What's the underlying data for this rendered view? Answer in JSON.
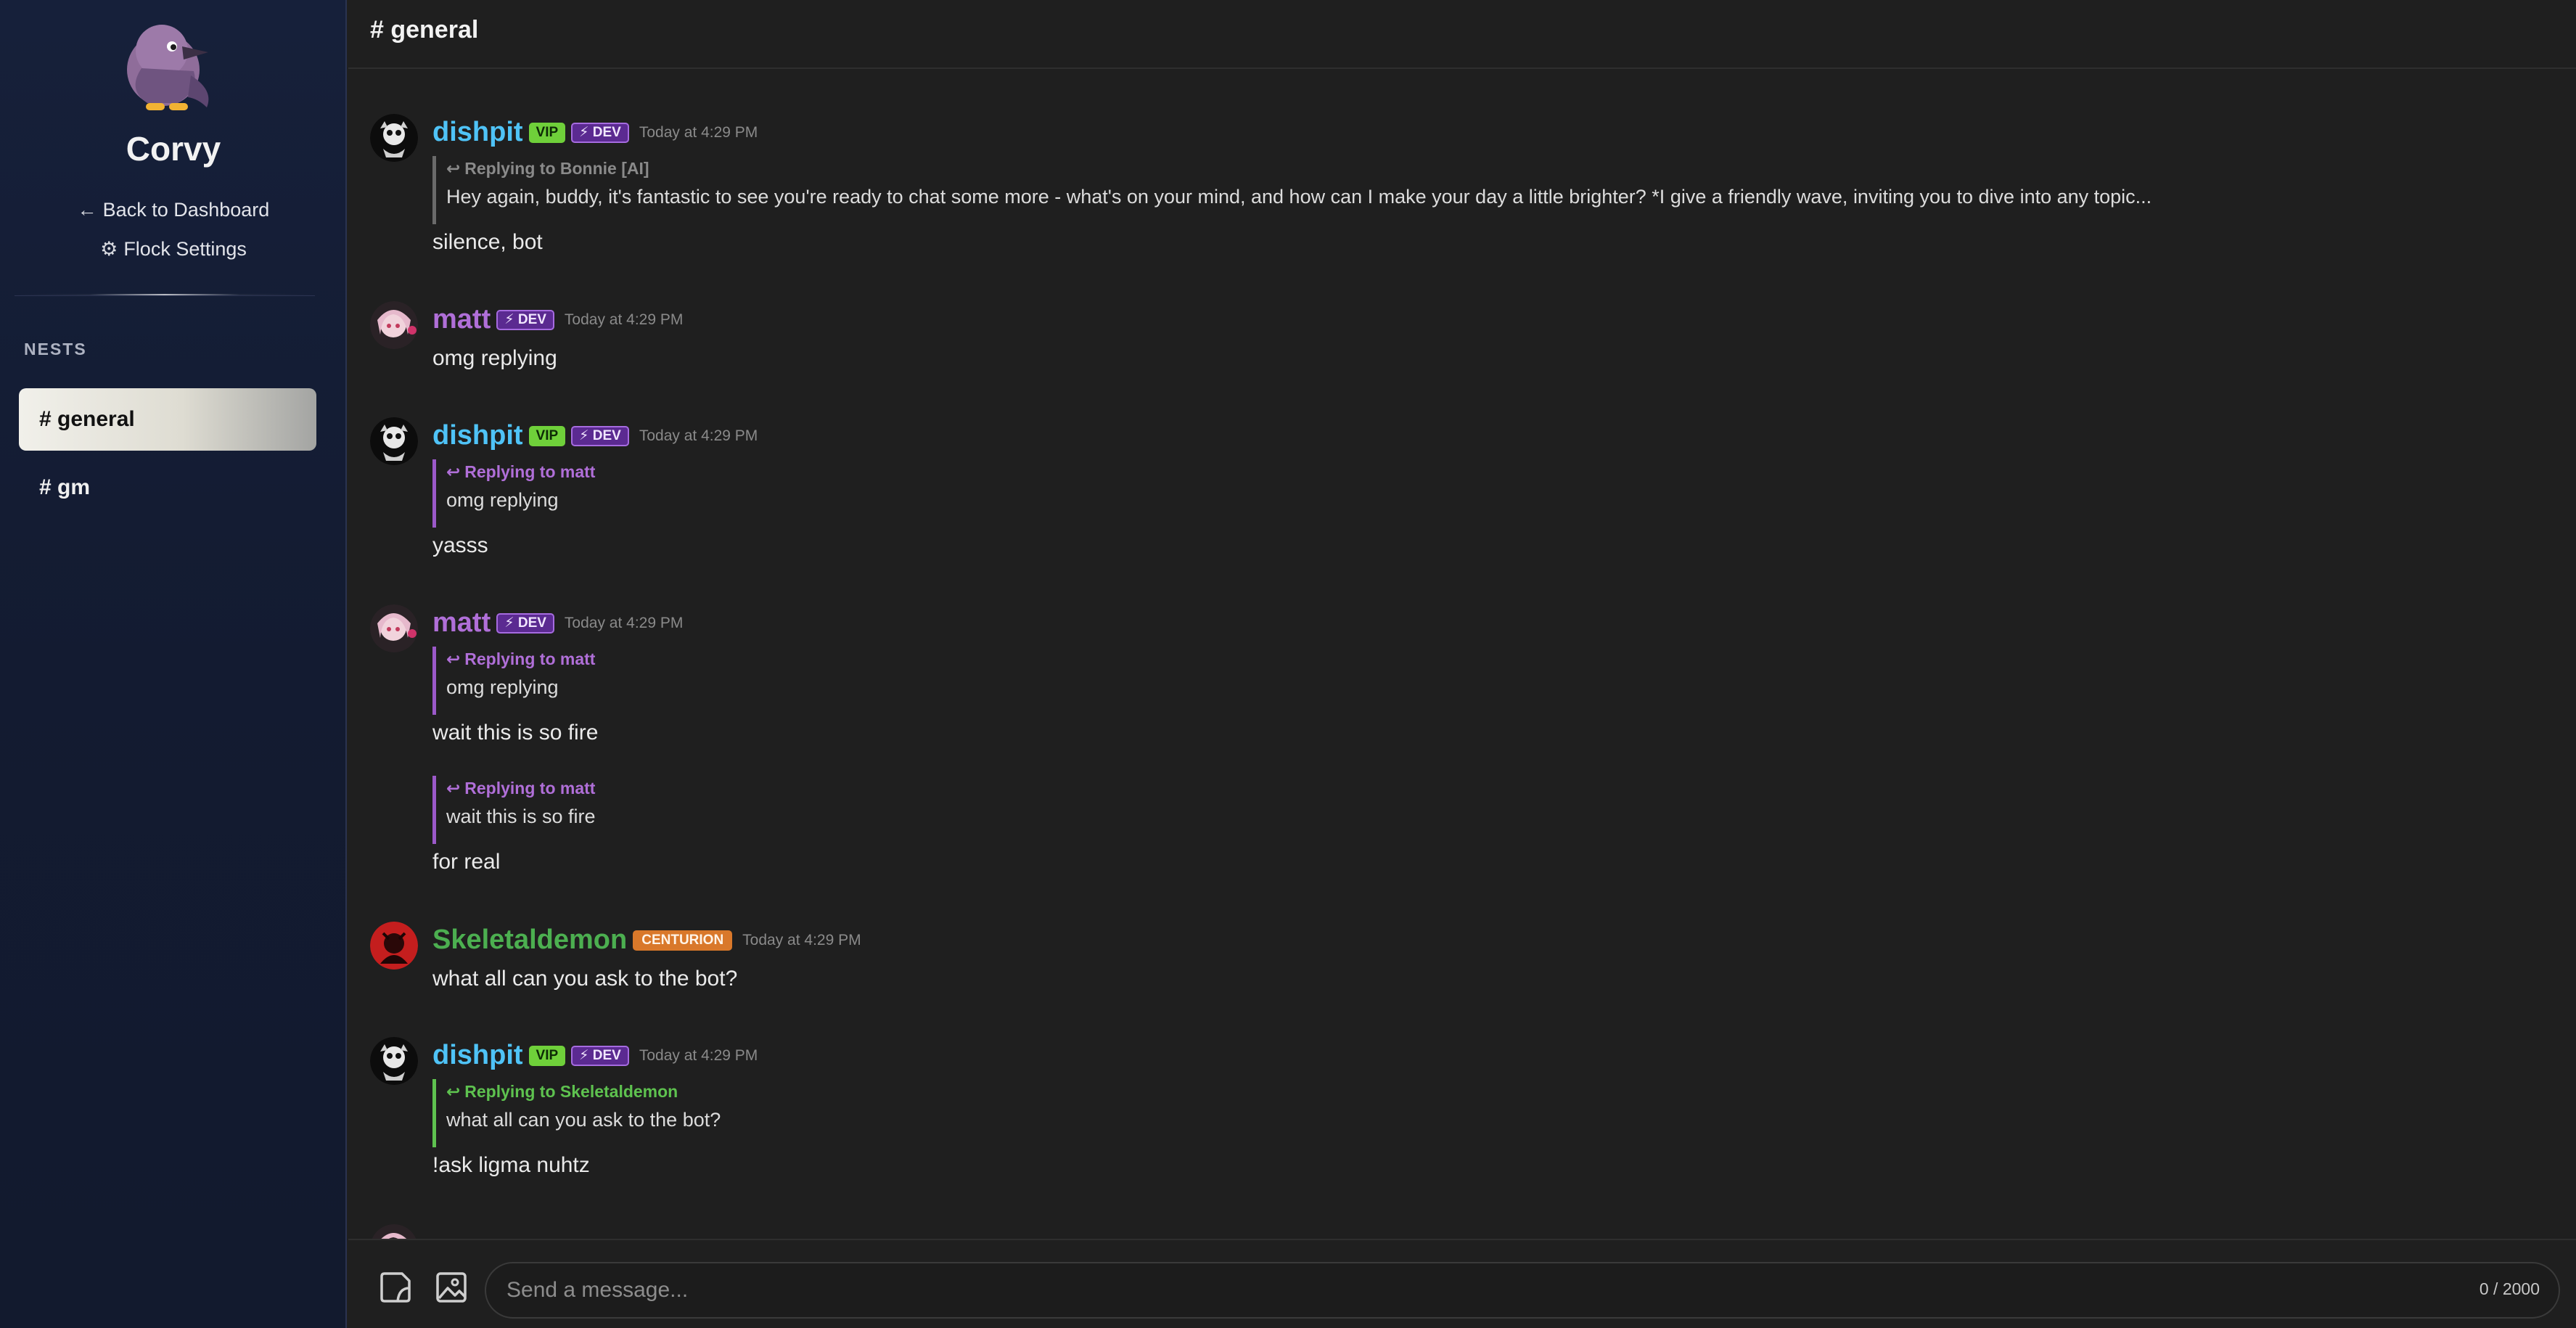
{
  "sidebar": {
    "brand": "Corvy",
    "back_label": "Back to Dashboard",
    "settings_label": "Flock Settings",
    "section_label": "NESTS",
    "nests": [
      {
        "label": "# general",
        "active": true
      },
      {
        "label": "# gm",
        "active": false
      }
    ]
  },
  "header": {
    "channel": "# general"
  },
  "messages": [
    {
      "user": "dishpit",
      "badges": [
        "VIP",
        "⚡ DEV"
      ],
      "time": "Today at 4:29 PM",
      "reply_to": "Replying to Bonnie [AI]",
      "reply_text": "Hey again, buddy, it's fantastic to see you're ready to chat some more - what's on your mind, and how can I make your day a little brighter? *I give a friendly wave, inviting you to dive into any topic...",
      "text": "silence, bot"
    },
    {
      "user": "matt",
      "badges": [
        "⚡ DEV"
      ],
      "time": "Today at 4:29 PM",
      "text": "omg replying"
    },
    {
      "user": "dishpit",
      "badges": [
        "VIP",
        "⚡ DEV"
      ],
      "time": "Today at 4:29 PM",
      "reply_to": "Replying to matt",
      "reply_text": "omg replying",
      "text": "yasss"
    },
    {
      "user": "matt",
      "badges": [
        "⚡ DEV"
      ],
      "time": "Today at 4:29 PM",
      "reply_to": "Replying to matt",
      "reply_text": "omg replying",
      "text": "wait this is so fire",
      "followup": {
        "reply_to": "Replying to matt",
        "reply_text": "wait this is so fire",
        "text": "for real"
      }
    },
    {
      "user": "Skeletaldemon",
      "badges": [
        "CENTURION"
      ],
      "time": "Today at 4:29 PM",
      "text": "what all can you ask to the bot?"
    },
    {
      "user": "dishpit",
      "badges": [
        "VIP",
        "⚡ DEV"
      ],
      "time": "Today at 4:29 PM",
      "reply_to": "Replying to Skeletaldemon",
      "reply_text": "what all can you ask to the bot?",
      "text": "!ask ligma nuhtz"
    }
  ],
  "composer": {
    "placeholder": "Send a message...",
    "counter": "0 / 2000"
  },
  "colors": {
    "sidebar_bg": "#16203a",
    "main_bg": "#1f1f1f",
    "dishpit": "#4fc3f7",
    "matt": "#b06fd8",
    "skeletaldemon": "#4caf50",
    "vip_badge": "#6fd03a",
    "dev_badge": "#5b2a91",
    "centurion_badge": "#d9782a"
  },
  "icons": {
    "back": "arrow-left-icon",
    "settings": "gear-icon",
    "reply": "reply-arrow-icon",
    "sticker": "sticker-icon",
    "image": "image-icon"
  }
}
